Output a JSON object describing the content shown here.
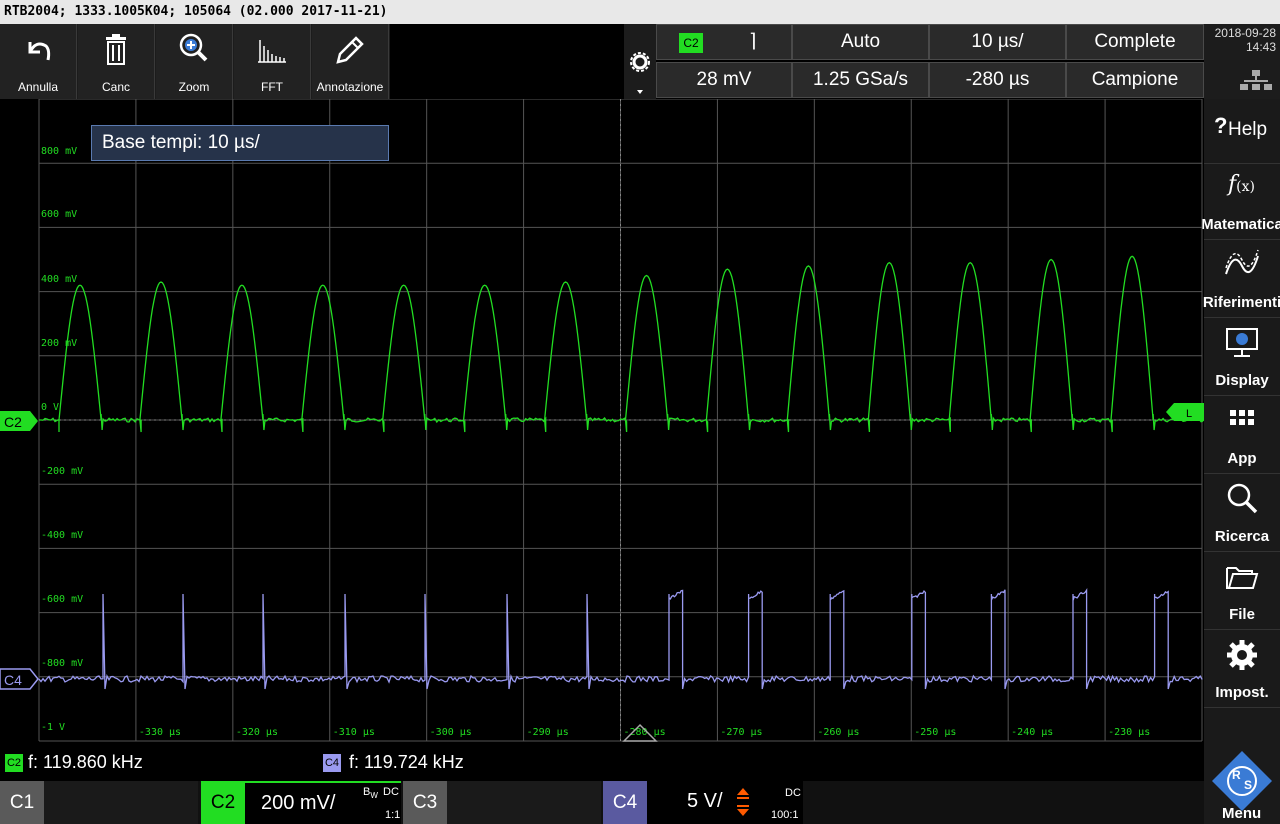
{
  "window": {
    "title": "RTB2004; 1333.1005K04; 105064 (02.000 2017-11-21)"
  },
  "toolbar": [
    {
      "label": "Annulla",
      "icon": "undo-icon"
    },
    {
      "label": "Canc",
      "icon": "trash-icon"
    },
    {
      "label": "Zoom",
      "icon": "zoom-icon"
    },
    {
      "label": "FFT",
      "icon": "fft-icon"
    },
    {
      "label": "Annotazione",
      "icon": "pencil-icon"
    }
  ],
  "params": {
    "channel": "C2",
    "slope": "⌉",
    "trigger_mode": "Auto",
    "timebase": "10 µs/",
    "acq_status": "Complete",
    "trigger_level": "28 mV",
    "sample_rate": "1.25 GSa/s",
    "offset": "-280 µs",
    "acq_mode": "Campione"
  },
  "clock": {
    "date": "2018-09-28",
    "time": "14:43"
  },
  "sidebar": [
    {
      "label": "Help",
      "icon": "help-icon"
    },
    {
      "label": "Matematica",
      "icon": "function-icon"
    },
    {
      "label": "Riferimenti",
      "icon": "reference-icon"
    },
    {
      "label": "Display",
      "icon": "display-icon"
    },
    {
      "label": "App",
      "icon": "apps-icon"
    },
    {
      "label": "Ricerca",
      "icon": "search-icon"
    },
    {
      "label": "File",
      "icon": "folder-icon"
    },
    {
      "label": "Impost.",
      "icon": "gear-icon"
    }
  ],
  "plot": {
    "info_box": "Base tempi: 10 µs/",
    "y_labels": [
      "800 mV",
      "600 mV",
      "400 mV",
      "200 mV",
      "0 V",
      "-200 mV",
      "-400 mV",
      "-600 mV",
      "-800 mV",
      "-1 V"
    ],
    "x_labels": [
      "-330 µs",
      "-320 µs",
      "-310 µs",
      "-300 µs",
      "-290 µs",
      "-280 µs",
      "-270 µs",
      "-260 µs",
      "-250 µs",
      "-240 µs",
      "-230 µs"
    ],
    "c2_marker": "C2",
    "c4_marker": "C4",
    "trigger_marker": "T"
  },
  "measurements": [
    {
      "channel": "C2",
      "text": "f: 119.860 kHz",
      "color": "#22dd22"
    },
    {
      "channel": "C4",
      "text": "f: 119.724 kHz",
      "color": "#9a9af0"
    }
  ],
  "channels": {
    "c1": {
      "name": "C1"
    },
    "c2": {
      "name": "C2",
      "scale": "200 mV/",
      "bw": "B",
      "bw_sub": "W",
      "coupling": "DC",
      "probe": "1:1"
    },
    "c3": {
      "name": "C3"
    },
    "c4": {
      "name": "C4",
      "scale": "5 V/",
      "coupling": "DC",
      "probe": "100:1"
    }
  },
  "menu": {
    "label": "Menu",
    "logo": "R&S"
  },
  "colors": {
    "c2": "#22dd22",
    "c4": "#9a9af0",
    "grid": "#555555"
  },
  "chart_data": {
    "type": "line",
    "xlabel": "",
    "ylabel": "",
    "xlim": [
      -340,
      -220
    ],
    "series": [
      {
        "name": "C2",
        "description_frequency_khz": 119.86,
        "peak_mV": [
          420,
          430,
          420,
          420,
          420,
          420,
          430,
          450,
          470,
          480,
          490,
          490,
          500,
          510
        ],
        "baseline_mV": 0
      },
      {
        "name": "C4",
        "description_frequency_khz": 119.724
      }
    ]
  }
}
